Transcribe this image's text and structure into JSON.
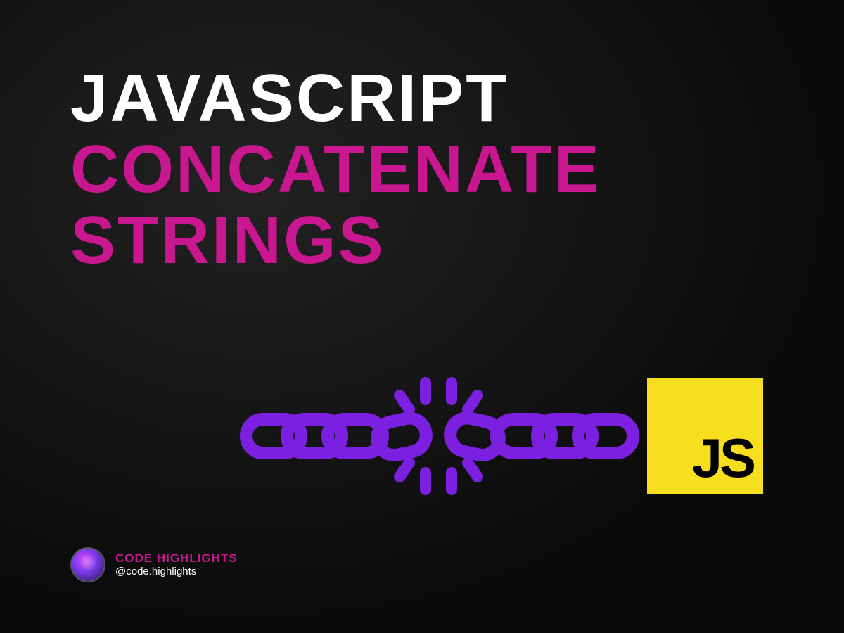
{
  "title": {
    "line1": "JAVASCRIPT",
    "line2": "CONCATENATE",
    "line3": "STRINGS"
  },
  "js_badge": {
    "label": "JS"
  },
  "footer": {
    "brand": "CODE HIGHLIGHTS",
    "handle": "@code.highlights"
  },
  "colors": {
    "white": "#ffffff",
    "magenta": "#c9178f",
    "purple": "#7b1fe0",
    "yellow": "#f7df1e",
    "black": "#000000"
  },
  "icons": {
    "chain": "chain-link-icon",
    "break": "chain-break-burst-icon",
    "js": "javascript-logo"
  }
}
